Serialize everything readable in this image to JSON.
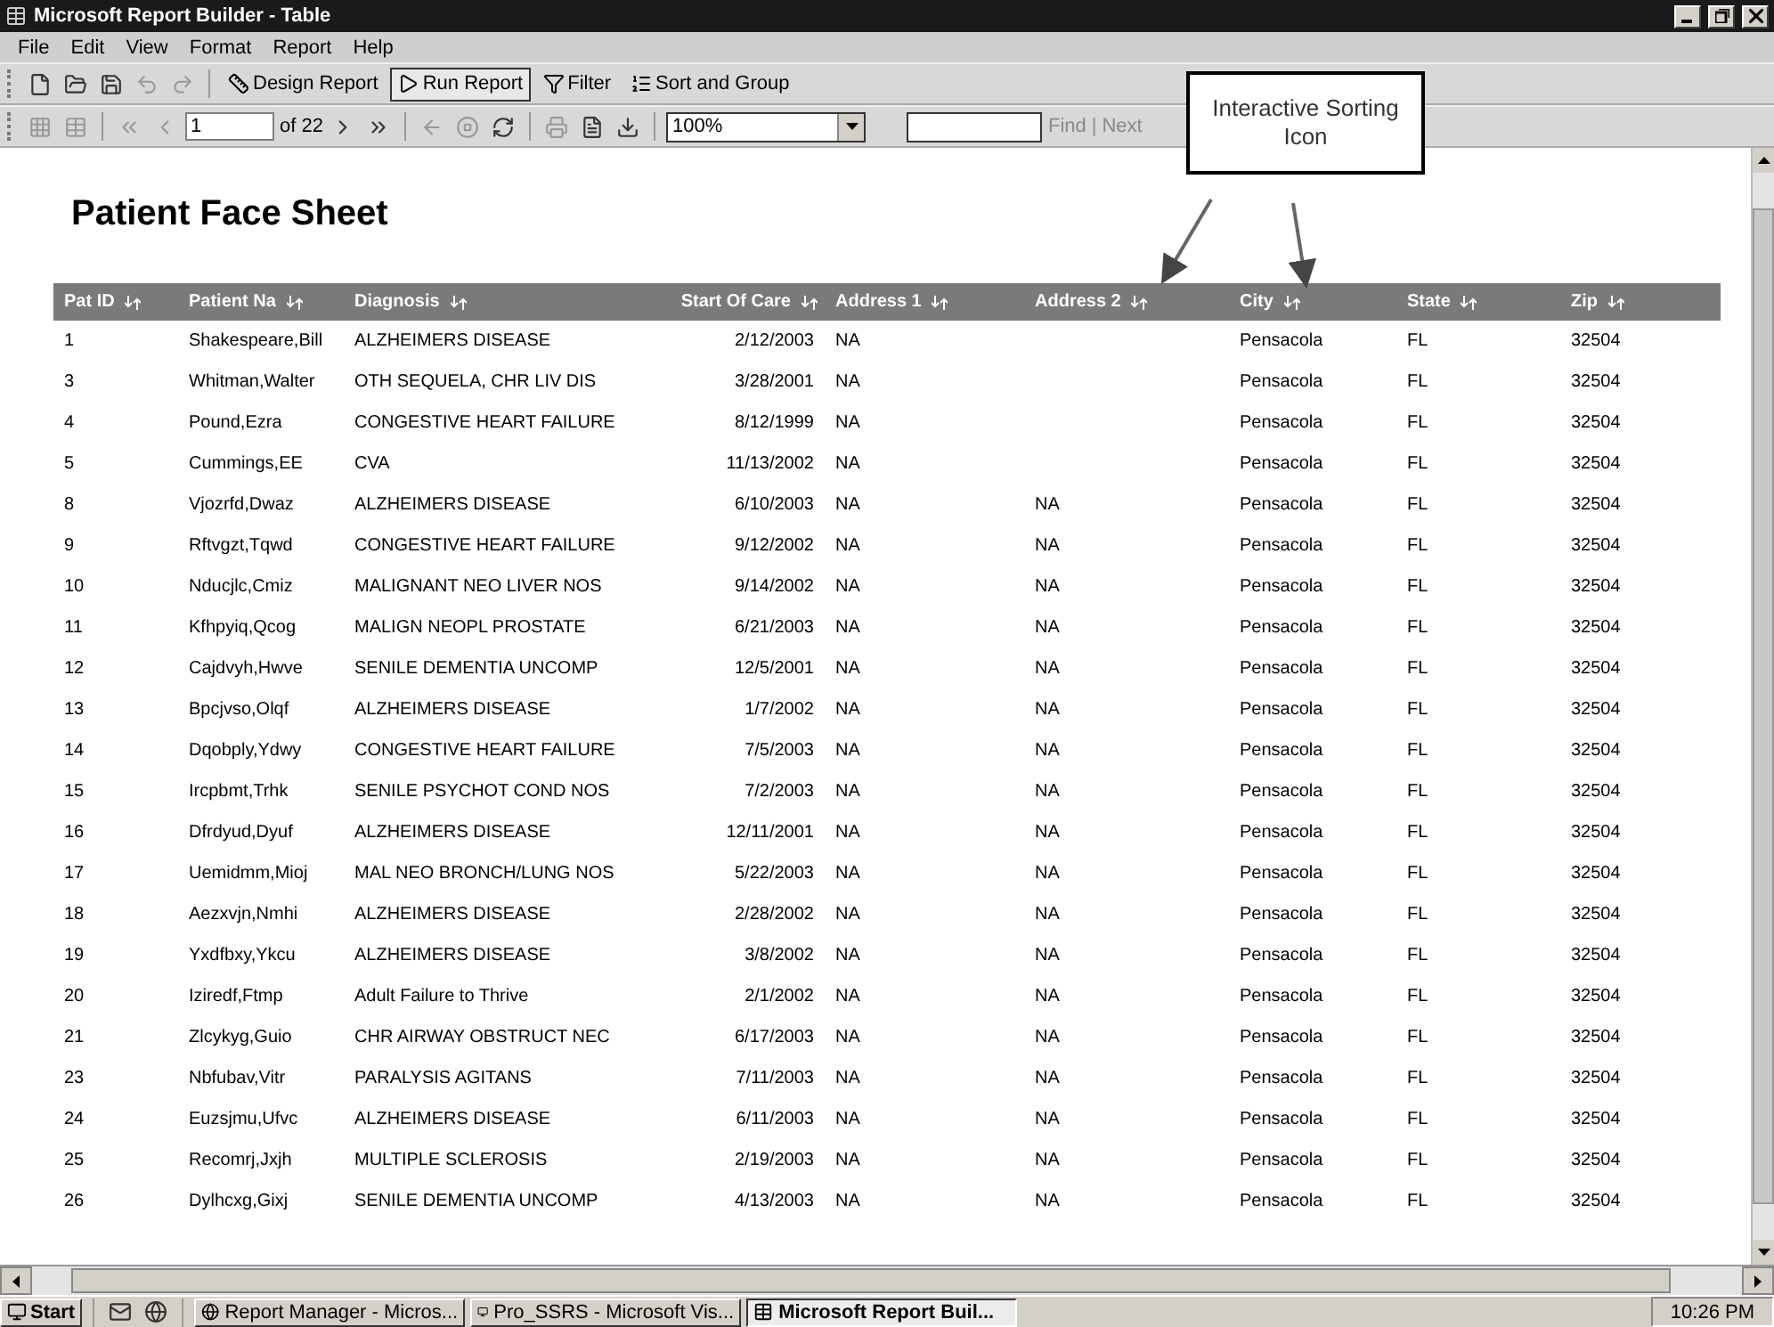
{
  "window": {
    "title": "Microsoft Report Builder - Table"
  },
  "menu": [
    "File",
    "Edit",
    "View",
    "Format",
    "Report",
    "Help"
  ],
  "toolbar": [
    {
      "label": "Design Report",
      "selected": false
    },
    {
      "label": "Run Report",
      "selected": true
    },
    {
      "label": "Filter",
      "selected": false
    },
    {
      "label": "Sort and Group",
      "selected": false
    }
  ],
  "navigation": {
    "page": "1",
    "page_count": "of 22",
    "zoom": "100%",
    "find": "Find",
    "separator": "|",
    "next": "Next"
  },
  "callout": {
    "text": "Interactive Sorting Icon"
  },
  "report": {
    "title": "Patient Face Sheet",
    "columns": [
      "Pat ID",
      "Patient Na",
      "Diagnosis",
      "Start Of Care",
      "Address 1",
      "Address 2",
      "City",
      "State",
      "Zip"
    ],
    "rows": [
      [
        "1",
        "Shakespeare,Bill",
        "ALZHEIMERS DISEASE",
        "2/12/2003",
        "NA",
        null,
        "Pensacola",
        "FL",
        "32504"
      ],
      [
        "3",
        "Whitman,Walter",
        "OTH SEQUELA, CHR LIV DIS",
        "3/28/2001",
        "NA",
        null,
        "Pensacola",
        "FL",
        "32504"
      ],
      [
        "4",
        "Pound,Ezra",
        "CONGESTIVE HEART FAILURE",
        "8/12/1999",
        "NA",
        null,
        "Pensacola",
        "FL",
        "32504"
      ],
      [
        "5",
        "Cummings,EE",
        "CVA",
        "11/13/2002",
        "NA",
        null,
        "Pensacola",
        "FL",
        "32504"
      ],
      [
        "8",
        "Vjozrfd,Dwaz",
        "ALZHEIMERS DISEASE",
        "6/10/2003",
        "NA",
        "NA",
        "Pensacola",
        "FL",
        "32504"
      ],
      [
        "9",
        "Rftvgzt,Tqwd",
        "CONGESTIVE HEART FAILURE",
        "9/12/2002",
        "NA",
        "NA",
        "Pensacola",
        "FL",
        "32504"
      ],
      [
        "10",
        "Nducjlc,Cmiz",
        "MALIGNANT NEO LIVER NOS",
        "9/14/2002",
        "NA",
        "NA",
        "Pensacola",
        "FL",
        "32504"
      ],
      [
        "11",
        "Kfhpyiq,Qcog",
        "MALIGN NEOPL PROSTATE",
        "6/21/2003",
        "NA",
        "NA",
        "Pensacola",
        "FL",
        "32504"
      ],
      [
        "12",
        "Cajdvyh,Hwve",
        "SENILE DEMENTIA UNCOMP",
        "12/5/2001",
        "NA",
        "NA",
        "Pensacola",
        "FL",
        "32504"
      ],
      [
        "13",
        "Bpcjvso,Olqf",
        "ALZHEIMERS DISEASE",
        "1/7/2002",
        "NA",
        "NA",
        "Pensacola",
        "FL",
        "32504"
      ],
      [
        "14",
        "Dqobply,Ydwy",
        "CONGESTIVE HEART FAILURE",
        "7/5/2003",
        "NA",
        "NA",
        "Pensacola",
        "FL",
        "32504"
      ],
      [
        "15",
        "Ircpbmt,Trhk",
        "SENILE PSYCHOT COND NOS",
        "7/2/2003",
        "NA",
        "NA",
        "Pensacola",
        "FL",
        "32504"
      ],
      [
        "16",
        "Dfrdyud,Dyuf",
        "ALZHEIMERS DISEASE",
        "12/11/2001",
        "NA",
        "NA",
        "Pensacola",
        "FL",
        "32504"
      ],
      [
        "17",
        "Uemidmm,Mioj",
        "MAL NEO BRONCH/LUNG NOS",
        "5/22/2003",
        "NA",
        "NA",
        "Pensacola",
        "FL",
        "32504"
      ],
      [
        "18",
        "Aezxvjn,Nmhi",
        "ALZHEIMERS DISEASE",
        "2/28/2002",
        "NA",
        "NA",
        "Pensacola",
        "FL",
        "32504"
      ],
      [
        "19",
        "Yxdfbxy,Ykcu",
        "ALZHEIMERS DISEASE",
        "3/8/2002",
        "NA",
        "NA",
        "Pensacola",
        "FL",
        "32504"
      ],
      [
        "20",
        "Iziredf,Ftmp",
        "Adult Failure to Thrive",
        "2/1/2002",
        "NA",
        "NA",
        "Pensacola",
        "FL",
        "32504"
      ],
      [
        "21",
        "Zlcykyg,Guio",
        "CHR AIRWAY OBSTRUCT NEC",
        "6/17/2003",
        "NA",
        "NA",
        "Pensacola",
        "FL",
        "32504"
      ],
      [
        "23",
        "Nbfubav,Vitr",
        "PARALYSIS AGITANS",
        "7/11/2003",
        "NA",
        "NA",
        "Pensacola",
        "FL",
        "32504"
      ],
      [
        "24",
        "Euzsjmu,Ufvc",
        "ALZHEIMERS DISEASE",
        "6/11/2003",
        "NA",
        "NA",
        "Pensacola",
        "FL",
        "32504"
      ],
      [
        "25",
        "Recomrj,Jxjh",
        "MULTIPLE SCLEROSIS",
        "2/19/2003",
        "NA",
        "NA",
        "Pensacola",
        "FL",
        "32504"
      ],
      [
        "26",
        "Dylhcxg,Gixj",
        "SENILE DEMENTIA UNCOMP",
        "4/13/2003",
        "NA",
        "NA",
        "Pensacola",
        "FL",
        "32504"
      ]
    ]
  },
  "taskbar": {
    "start": "Start",
    "tasks": [
      {
        "label": "Report Manager - Micros...",
        "selected": false
      },
      {
        "label": "Pro_SSRS - Microsoft Vis...",
        "selected": false
      },
      {
        "label": "Microsoft Report Buil...",
        "selected": true
      }
    ],
    "clock": "10:26 PM"
  }
}
